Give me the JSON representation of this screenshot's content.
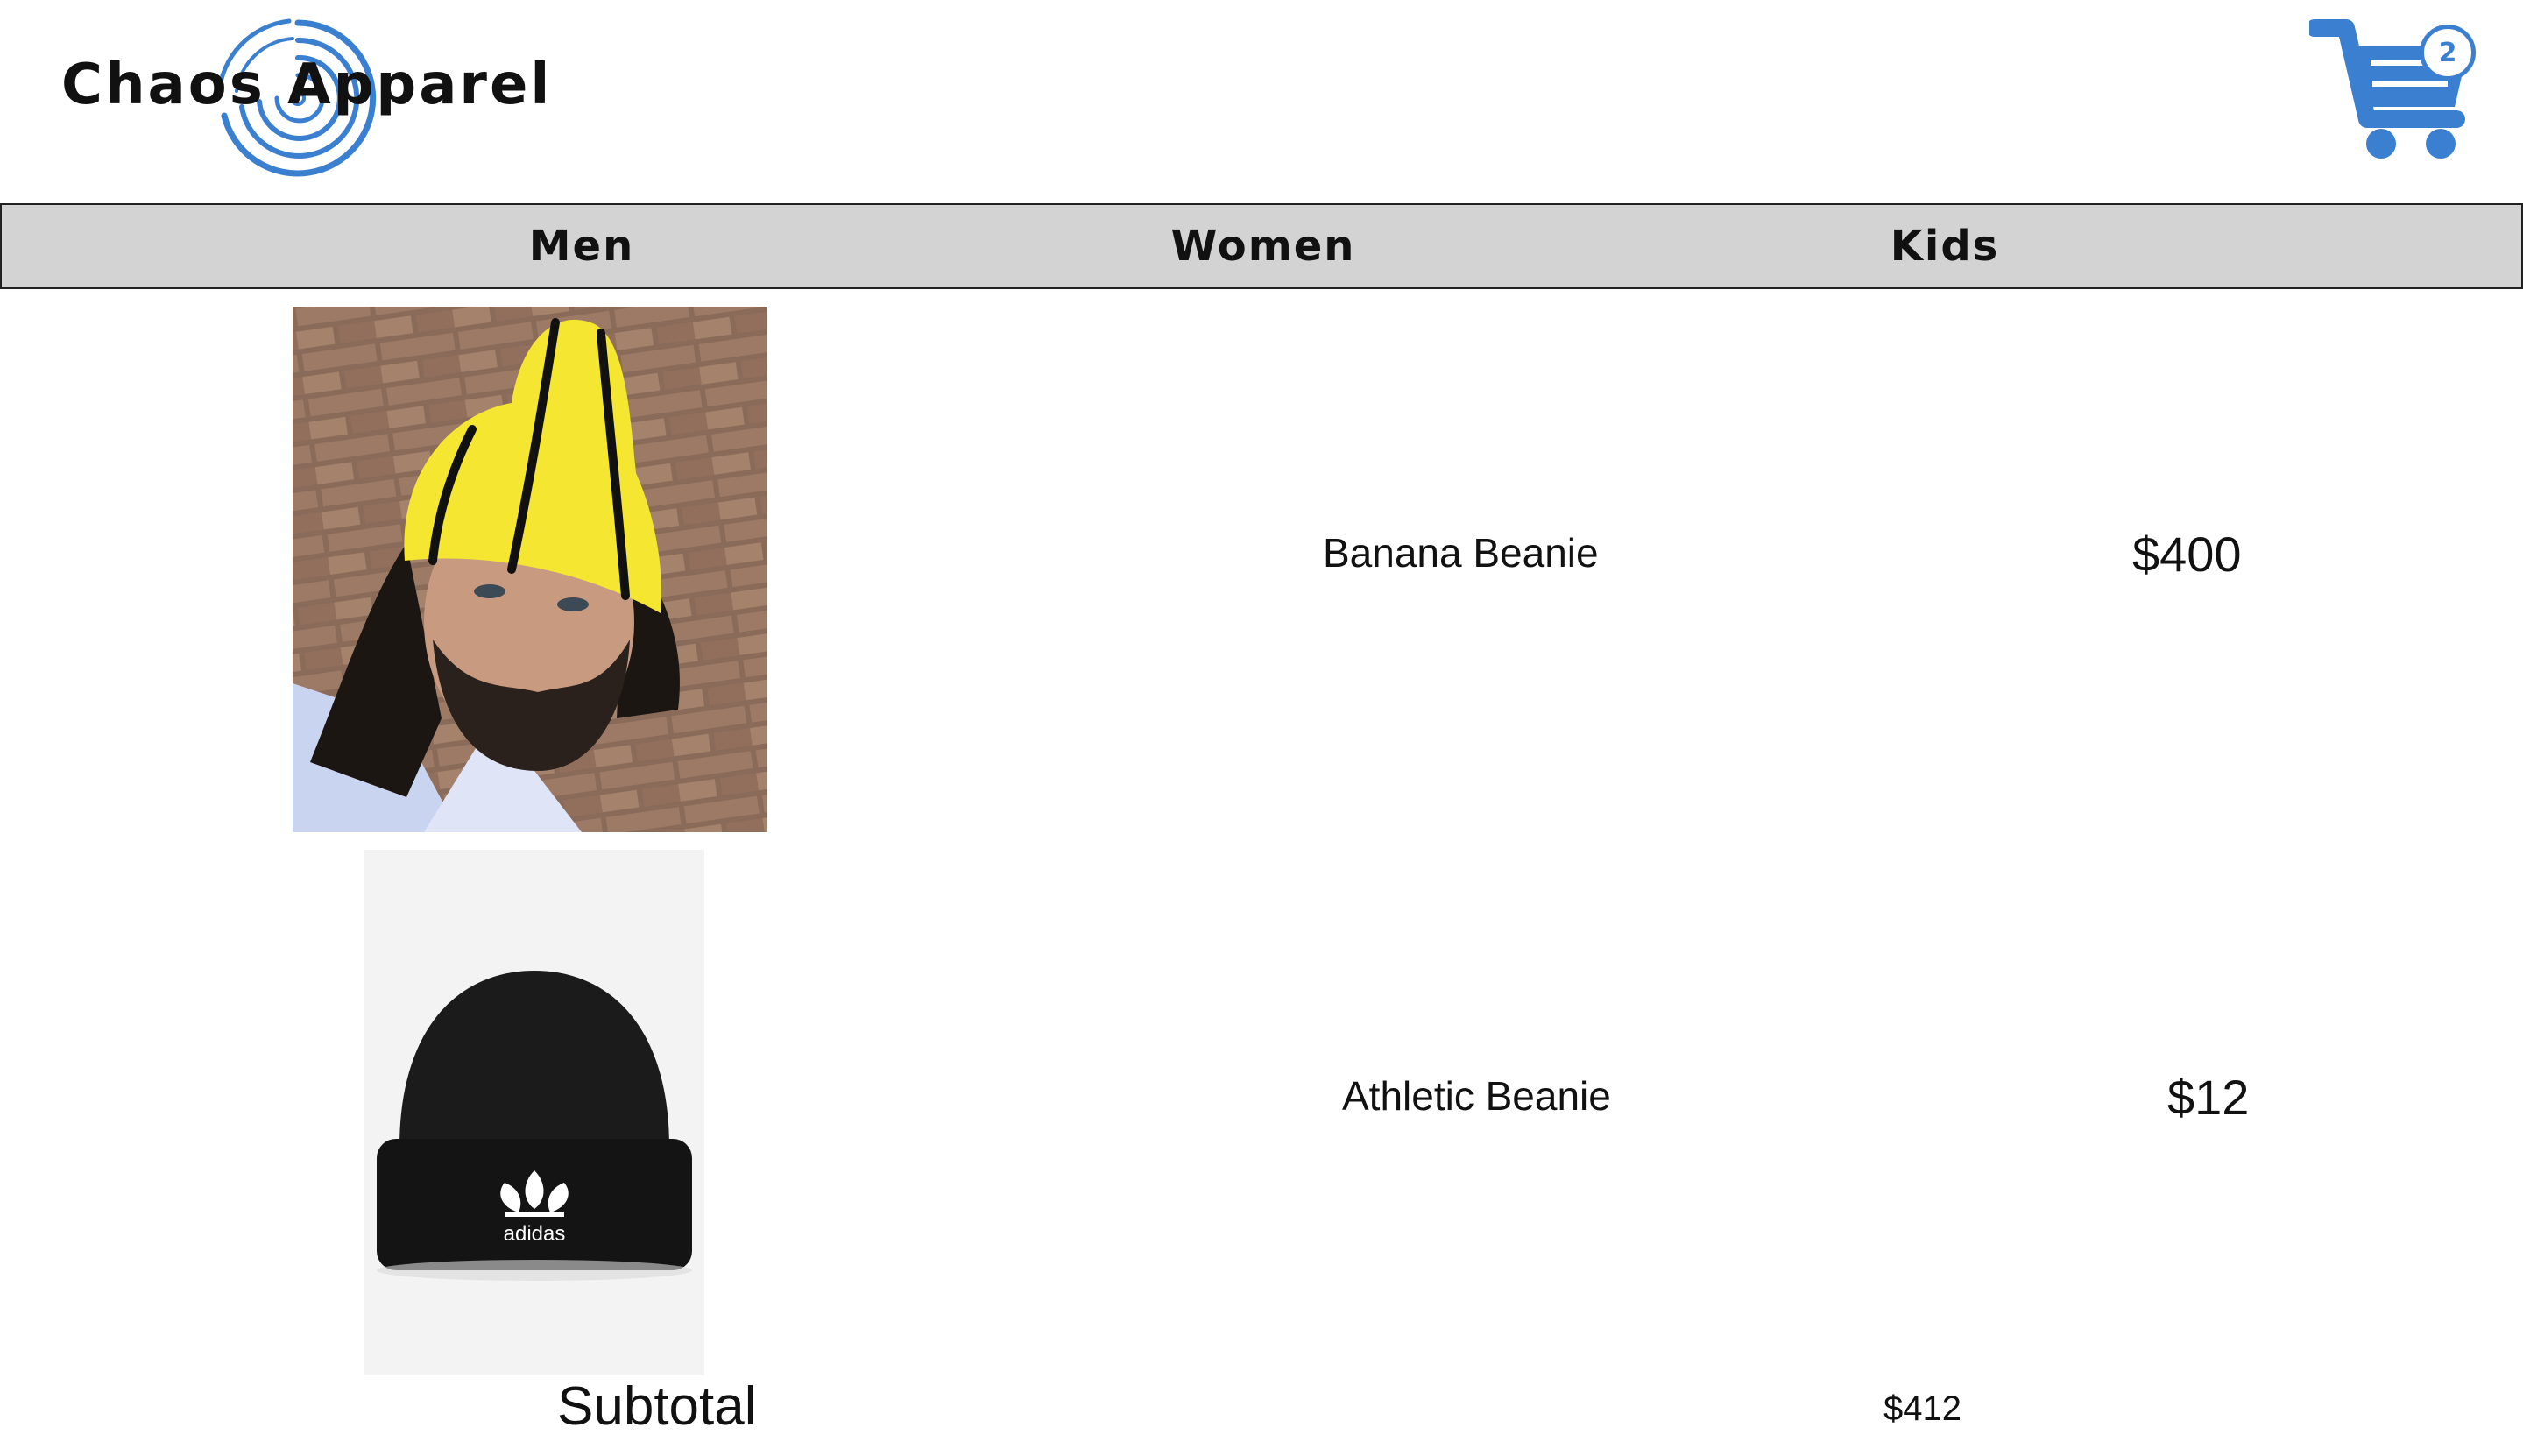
{
  "header": {
    "brand": "Chaos Apparel",
    "cart_count": "2"
  },
  "nav": {
    "items": [
      {
        "label": "Men"
      },
      {
        "label": "Women"
      },
      {
        "label": "Kids"
      }
    ]
  },
  "cart": {
    "items": [
      {
        "name": "Banana Beanie",
        "price": "$400",
        "image": "yellow-black-striped-knit-beanie-photo"
      },
      {
        "name": "Athletic Beanie",
        "price": "$12",
        "image": "black-adidas-beanie-photo"
      }
    ],
    "subtotal_label": "Subtotal",
    "subtotal_value": "$412"
  },
  "colors": {
    "brand_blue": "#3a7fd0",
    "nav_background": "#d3d3d3",
    "nav_border": "#222222"
  }
}
